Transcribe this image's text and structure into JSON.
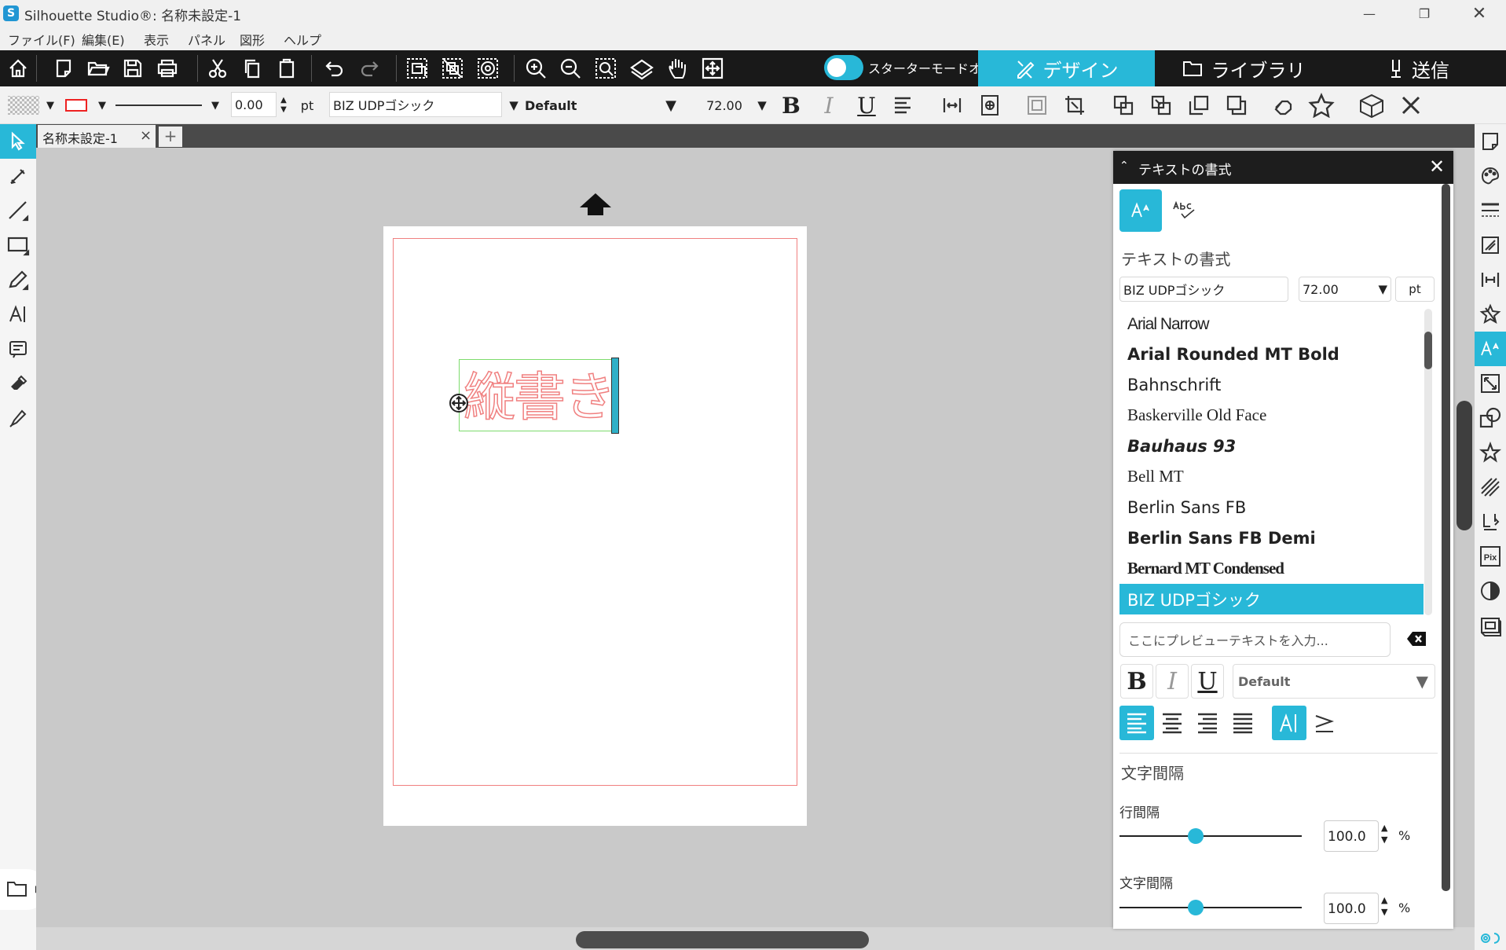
{
  "window": {
    "title": "Silhouette Studio®: 名称未設定-1",
    "logo": "S",
    "minimize": "—",
    "maximize": "❐",
    "close": "✕"
  },
  "menu": [
    "ファイル(F)",
    "編集(E)",
    "表示",
    "パネル",
    "図形",
    "ヘルプ"
  ],
  "toolbar": {
    "starter_mode_label": "スターターモードオフ",
    "tabs": {
      "design": "デザイン",
      "library": "ライブラリ",
      "send": "送信"
    }
  },
  "props": {
    "line_width": "0.00",
    "unit": "pt",
    "font": "BIZ UDPゴシック",
    "style": "Default",
    "size": "72.00",
    "bold": "B",
    "italic": "I",
    "underline": "U"
  },
  "document": {
    "tab": "名称未設定-1",
    "tab_close": "×",
    "add_tab": "+",
    "text": "縦書き"
  },
  "panel": {
    "title": "テキストの書式",
    "close": "✕",
    "section_label": "テキストの書式",
    "font_field": "BIZ UDPゴシック",
    "size_field": "72.00",
    "size_unit": "pt",
    "fonts": [
      "Arial Narrow",
      "Arial Rounded MT Bold",
      "Bahnschrift",
      "Baskerville Old Face",
      "Bauhaus 93",
      "Bell MT",
      "Berlin Sans FB",
      "Berlin Sans FB Demi",
      "Bernard MT Condensed",
      "BIZ UDPゴシック"
    ],
    "preview_placeholder": "ここにプレビューテキストを入力...",
    "format_bold": "B",
    "format_italic": "I",
    "format_underline": "U",
    "style_select": "Default",
    "spacing_section": "文字間隔",
    "line_spacing": {
      "label": "行間隔",
      "value": "100.0",
      "unit": "%",
      "level": 0.42
    },
    "char_spacing": {
      "label": "文字間隔",
      "value": "100.0",
      "unit": "%",
      "level": 0.42
    }
  },
  "colors": {
    "accent": "#28b8d8",
    "cut_line": "#f08080",
    "selection": "#7ddb6c",
    "toolbar_bg": "#191919"
  }
}
